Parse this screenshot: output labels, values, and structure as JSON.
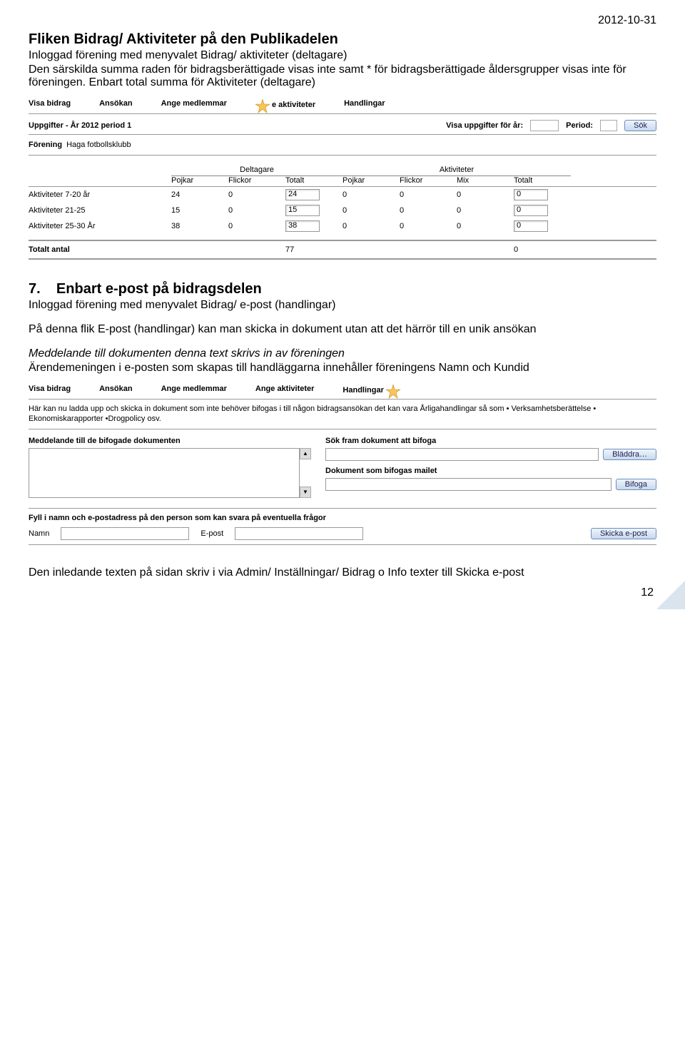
{
  "date": "2012-10-31",
  "header": {
    "title": "Fliken Bidrag/ Aktiviteter på den Publikadelen",
    "line1": "Inloggad förening med menyvalet Bidrag/ aktiviteter (deltagare)",
    "line2": "Den särskilda summa raden för bidragsberättigade visas inte samt * för bidragsberättigade åldersgrupper visas inte för föreningen. Enbart total summa för Aktiviteter (deltagare)"
  },
  "screenshot1": {
    "tabs": [
      "Visa bidrag",
      "Ansökan",
      "Ange medlemmar",
      "Ange aktiviteter",
      "Handlingar"
    ],
    "active_tab_partial": "e aktiviteter",
    "uppgifter_label": "Uppgifter - År 2012 period 1",
    "visa_label": "Visa uppgifter för år:",
    "period_label": "Period:",
    "sok_label": "Sök",
    "forening_label": "Förening",
    "forening_name": "Haga fotbollsklubb",
    "group1": "Deltagare",
    "group2": "Aktiviteter",
    "cols": [
      "Pojkar",
      "Flickor",
      "Totalt",
      "Pojkar",
      "Flickor",
      "Mix",
      "Totalt"
    ],
    "rows": [
      {
        "name": "Aktiviteter 7-20 år",
        "vals": [
          "24",
          "0",
          "24",
          "0",
          "0",
          "0",
          "0"
        ]
      },
      {
        "name": "Aktiviteter 21-25",
        "vals": [
          "15",
          "0",
          "15",
          "0",
          "0",
          "0",
          "0"
        ]
      },
      {
        "name": "Aktiviteter 25-30 År",
        "vals": [
          "38",
          "0",
          "38",
          "0",
          "0",
          "0",
          "0"
        ]
      }
    ],
    "total_label": "Totalt antal",
    "total_t1": "77",
    "total_t2": "0"
  },
  "section7": {
    "num": "7.",
    "title": "Enbart e-post på bidragsdelen",
    "line1": "Inloggad förening med menyvalet Bidrag/ e-post (handlingar)",
    "line2": "På denna flik E-post (handlingar) kan man skicka in dokument utan att det härrör till en unik ansökan",
    "line3": "Meddelande till dokumenten denna text skrivs in av föreningen",
    "line4": "Ärendemeningen i e-posten som skapas till handläggarna innehåller föreningens Namn och Kundid"
  },
  "screenshot2": {
    "tabs": [
      "Visa bidrag",
      "Ansökan",
      "Ange medlemmar",
      "Ange aktiviteter",
      "Handlingar"
    ],
    "desc": "Här kan nu ladda upp och skicka in dokument som inte behöver bifogas i till någon bidragsansökan det kan vara Årligahandlingar så som • Verksamhetsberättelse • Ekonomiskarapporter •Drogpolicy osv.",
    "meddelande_label": "Meddelande till de bifogade dokumenten",
    "sok_fram_label": "Sök fram dokument att bifoga",
    "bladdra_label": "Bläddra…",
    "dokument_label": "Dokument som bifogas mailet",
    "bifoga_label": "Bifoga",
    "fyll_label": "Fyll i namn och e-postadress på den person som kan svara på eventuella frågor",
    "namn_label": "Namn",
    "epost_label": "E-post",
    "skicka_label": "Skicka e-post"
  },
  "footer_text": "Den inledande texten på sidan skriv i via Admin/ Inställningar/ Bidrag o Info texter till Skicka e-post",
  "page_num": "12"
}
